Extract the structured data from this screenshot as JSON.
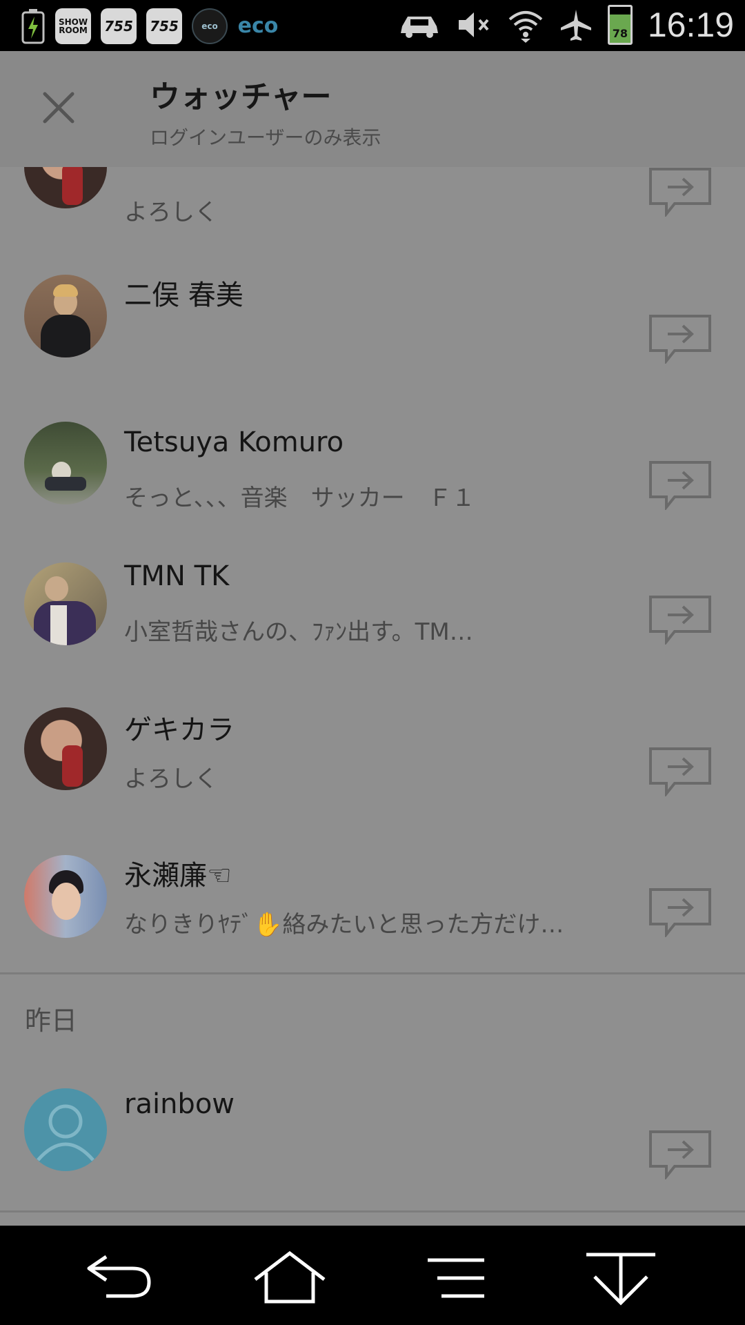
{
  "status_bar": {
    "left_icons": [
      {
        "name": "battery-charging-icon"
      },
      {
        "name": "showroom-app-icon",
        "label": "SHOW\nROOM"
      },
      {
        "name": "755-app-icon",
        "label": "755"
      },
      {
        "name": "755-app-icon-2",
        "label": "755"
      },
      {
        "name": "eco-ring-icon",
        "label": "eco"
      },
      {
        "name": "eco-app-icon",
        "label": "eco"
      }
    ],
    "right_icons": [
      "car-icon",
      "mute-icon",
      "wifi-icon",
      "airplane-icon",
      "battery-icon"
    ],
    "battery_level": "78",
    "time": "16:19"
  },
  "header": {
    "title": "ウォッチャー",
    "subtitle": "ログインユーザーのみ表示",
    "close_icon": "close-icon"
  },
  "watchers": [
    {
      "name": "",
      "message": "よろしく",
      "avatar": "woman-avatar"
    },
    {
      "name": "二俣 春美",
      "message": "",
      "avatar": "man-suit-avatar"
    },
    {
      "name": "Tetsuya Komuro",
      "message": "そっと、、、音楽　サッカー　Ｆ１",
      "avatar": "outdoor-avatar"
    },
    {
      "name": "TMN TK",
      "message": "小室哲哉さんの、ﾌｧﾝ出す。TM…",
      "avatar": "purple-jacket-avatar"
    },
    {
      "name": "ゲキカラ",
      "message": "よろしく",
      "avatar": "woman-avatar"
    },
    {
      "name": "永瀬廉☜",
      "message": "なりきりﾔﾃﾞ✋絡みたいと思った方だけ…",
      "avatar": "young-man-avatar"
    }
  ],
  "section_yesterday": {
    "label": "昨日",
    "watchers": [
      {
        "name": "rainbow",
        "message": "",
        "avatar": "default-avatar"
      }
    ]
  },
  "colors": {
    "overlay_bg": "#8f8f8f",
    "header_bg": "#898989",
    "default_avatar": "#4d93a8",
    "icon_gray": "#6a6a6a"
  },
  "nav_bar": {
    "buttons": [
      "back-button",
      "home-button",
      "menu-button",
      "notification-pull-button"
    ]
  }
}
